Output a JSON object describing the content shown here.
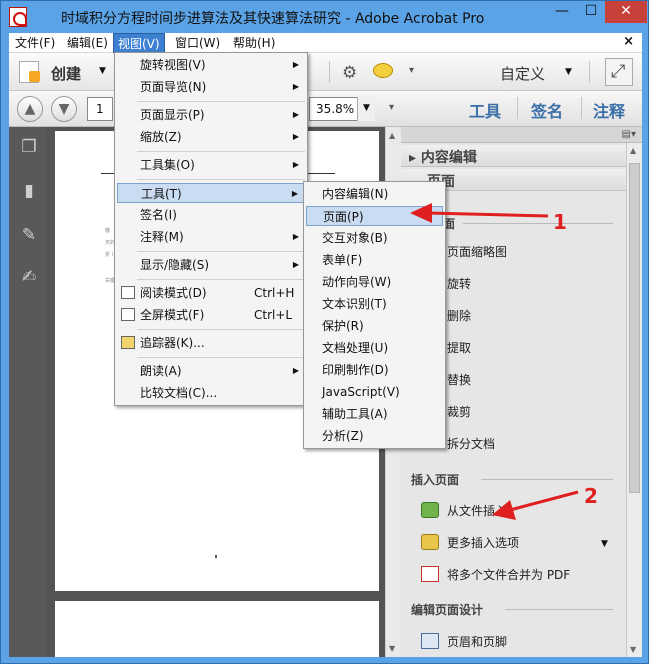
{
  "window": {
    "title": "时域积分方程时间步进算法及其快速算法研究 - Adobe Acrobat Pro",
    "min": "—",
    "max": "☐",
    "close": "✕"
  },
  "menubar": {
    "items": [
      {
        "label": "文件(F)"
      },
      {
        "label": "编辑(E)"
      },
      {
        "label": "视图(V)"
      },
      {
        "label": "窗口(W)"
      },
      {
        "label": "帮助(H)"
      }
    ],
    "close": "×"
  },
  "toolbar": {
    "create_label": "创建",
    "custom_label": "自定义"
  },
  "nav": {
    "page_number": "1",
    "zoom": "35.8%"
  },
  "panel_tabs": {
    "tools": "工具",
    "sign": "签名",
    "comment": "注释"
  },
  "view_menu": {
    "items": [
      {
        "label": "旋转视图(V)"
      },
      {
        "label": "页面导览(N)"
      },
      {
        "label": "页面显示(P)"
      },
      {
        "label": "缩放(Z)"
      },
      {
        "label": "工具集(O)"
      },
      {
        "label": "工具(T)"
      },
      {
        "label": "签名(I)"
      },
      {
        "label": "注释(M)"
      },
      {
        "label": "显示/隐藏(S)"
      },
      {
        "label": "阅读模式(D)",
        "shortcut": "Ctrl+H"
      },
      {
        "label": "全屏模式(F)",
        "shortcut": "Ctrl+L"
      },
      {
        "label": "追踪器(K)..."
      },
      {
        "label": "朗读(A)"
      },
      {
        "label": "比较文档(C)..."
      }
    ]
  },
  "tools_menu": {
    "items": [
      {
        "label": "内容编辑(N)"
      },
      {
        "label": "页面(P)"
      },
      {
        "label": "交互对象(B)"
      },
      {
        "label": "表单(F)"
      },
      {
        "label": "动作向导(W)"
      },
      {
        "label": "文本识别(T)"
      },
      {
        "label": "保护(R)"
      },
      {
        "label": "文档处理(U)"
      },
      {
        "label": "印刷制作(D)"
      },
      {
        "label": "JavaScript(V)"
      },
      {
        "label": "辅助工具(A)"
      },
      {
        "label": "分析(Z)"
      }
    ]
  },
  "right_panel": {
    "section_content_edit": "内容编辑",
    "section_pages": "页面",
    "sub_pages": "页面",
    "page_items": [
      {
        "label": "页面缩略图"
      },
      {
        "label": "旋转"
      },
      {
        "label": "删除"
      },
      {
        "label": "提取"
      },
      {
        "label": "替换"
      },
      {
        "label": "裁剪"
      },
      {
        "label": "拆分文档"
      }
    ],
    "sub_insert": "插入页面",
    "insert_items": [
      {
        "label": "从文件插入"
      },
      {
        "label": "更多插入选项"
      },
      {
        "label": "将多个文件合并为 PDF"
      }
    ],
    "sub_design": "编辑页面设计",
    "design_items": [
      {
        "label": "页眉和页脚"
      }
    ]
  },
  "document": {
    "snippets": [
      "敬",
      "天的",
      "折 ⅰ",
      "关键"
    ]
  },
  "annotations": {
    "one": "1",
    "two": "2"
  },
  "colors": {
    "title_bar": "#5aa3e6",
    "menu_highlight": "#c9dcf1",
    "annotation": "#e02020",
    "panel_tab": "#3b6fa8"
  }
}
